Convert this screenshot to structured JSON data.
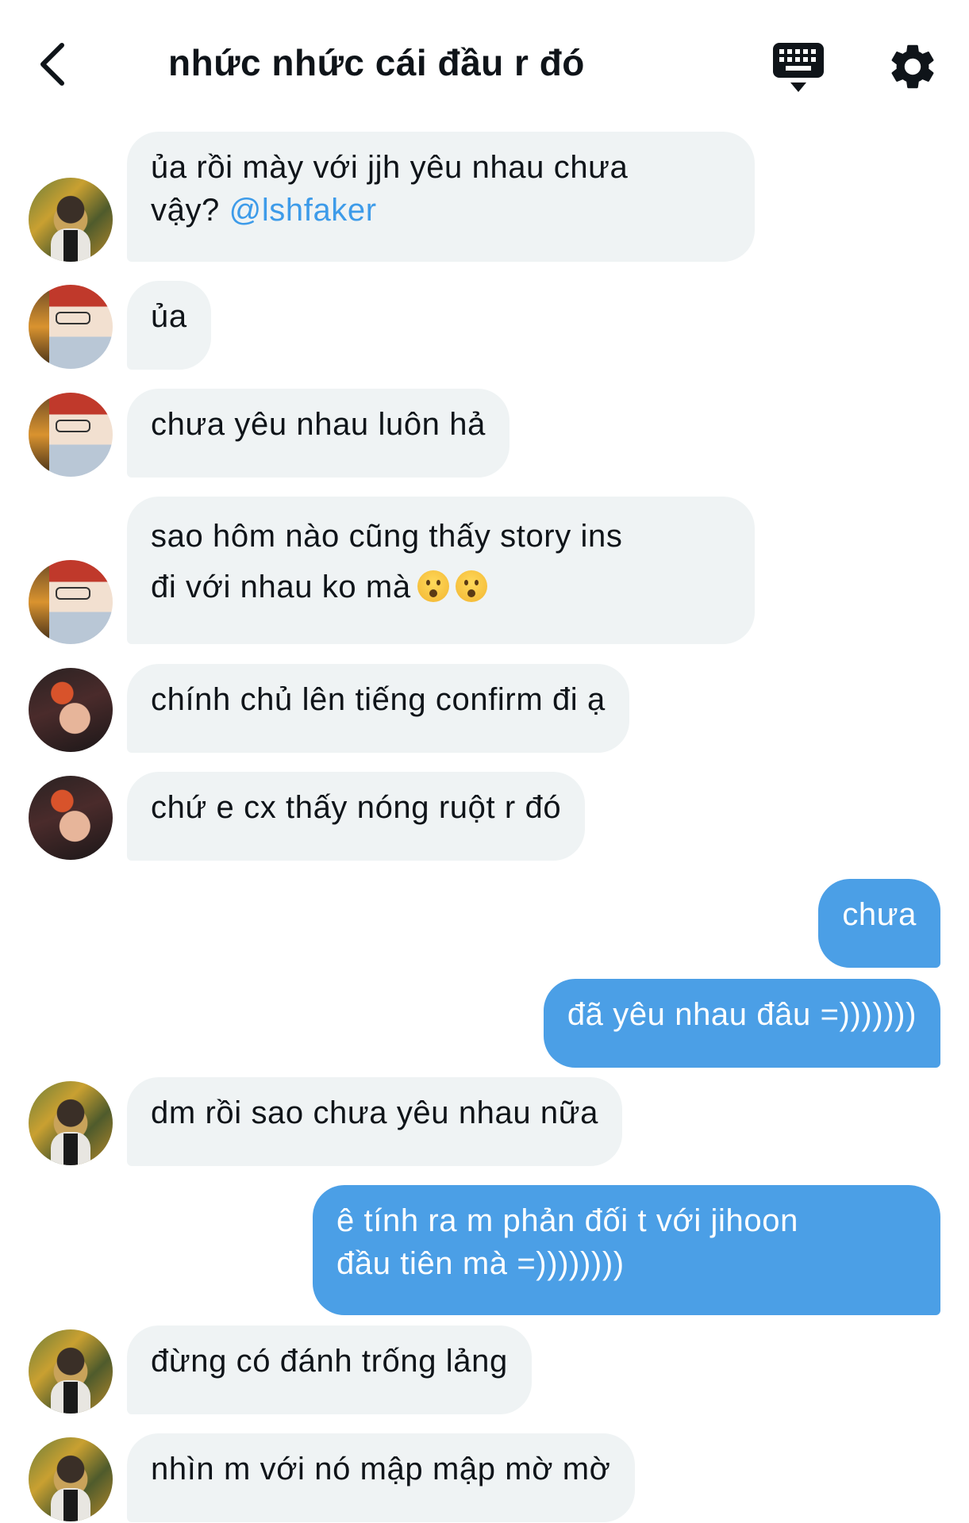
{
  "header": {
    "title": "nhức nhức cái đầu r đó",
    "icons": {
      "back": "chevron-left-icon",
      "keyboard": "keyboard-icon",
      "settings": "gear-icon"
    }
  },
  "colors": {
    "incoming_bubble": "#eff3f4",
    "outgoing_bubble": "#4b9fe6",
    "mention": "#3d9be9"
  },
  "messages": [
    {
      "dir": "in",
      "line1": "ủa rồi mày với jjh yêu nhau chưa",
      "line2_prefix": "vậy? ",
      "mention": "@lshfaker"
    },
    {
      "dir": "in",
      "text": "ủa"
    },
    {
      "dir": "in",
      "text": "chưa yêu nhau luôn hả"
    },
    {
      "dir": "in",
      "line1": "sao hôm nào cũng thấy story ins",
      "line2": "đi với nhau ko mà",
      "emoji": "astonished-face"
    },
    {
      "dir": "in",
      "text": "chính chủ lên tiếng confirm đi ạ"
    },
    {
      "dir": "in",
      "text": "chứ e cx thấy nóng ruột r đó"
    },
    {
      "dir": "out",
      "text": "chưa"
    },
    {
      "dir": "out",
      "text": "đã yêu nhau đâu =)))))))"
    },
    {
      "dir": "in",
      "text": "dm rồi sao chưa yêu nhau nữa"
    },
    {
      "dir": "out",
      "line1": "ê tính ra m phản đối t với jihoon",
      "line2": "đầu tiên mà =))))))))"
    },
    {
      "dir": "in",
      "text": "đừng có đánh trống lảng"
    },
    {
      "dir": "in",
      "text": "nhìn m với nó mập mập mờ mờ"
    }
  ]
}
